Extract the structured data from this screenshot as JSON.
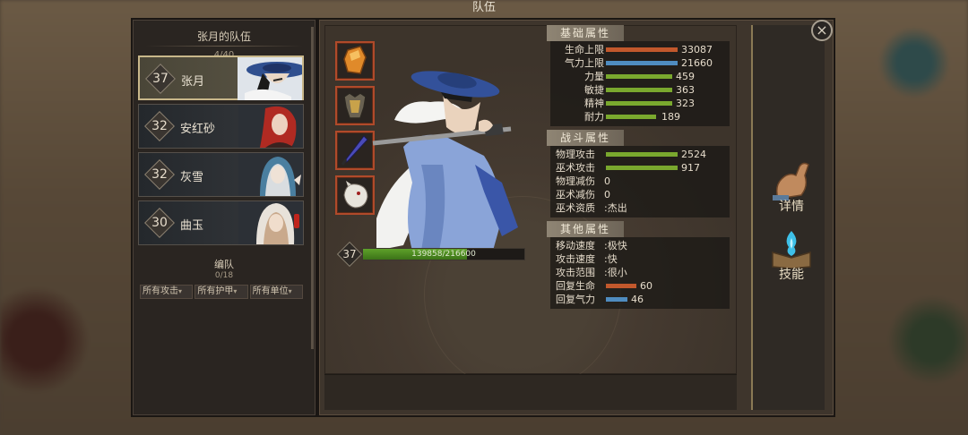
{
  "window": {
    "title": "队伍",
    "close_icon": "close-icon"
  },
  "team": {
    "title": "张月的队伍",
    "count": "4/40",
    "heroes": [
      {
        "level": "37",
        "name": "张月",
        "selected": true,
        "warning": false
      },
      {
        "level": "32",
        "name": "安红砂",
        "selected": false,
        "warning": false
      },
      {
        "level": "32",
        "name": "灰雪",
        "selected": false,
        "warning": false
      },
      {
        "level": "30",
        "name": "曲玉",
        "selected": false,
        "warning": true
      }
    ],
    "formation_title": "编队",
    "formation_count": "0/18",
    "filters": [
      "所有攻击",
      "所有护甲",
      "所有单位"
    ]
  },
  "equipment": [
    {
      "name": "amber-gem-icon"
    },
    {
      "name": "armor-icon"
    },
    {
      "name": "blade-icon"
    },
    {
      "name": "beast-head-icon"
    }
  ],
  "hero": {
    "level": "37",
    "hp_text": "139858/216600",
    "hp_fraction": 0.6457
  },
  "stats": {
    "basic": {
      "header": "基础属性",
      "rows": [
        {
          "label": "生命上限",
          "value": "33087",
          "color": "#c2582c",
          "fill": 0.97
        },
        {
          "label": "气力上限",
          "value": "21660",
          "color": "#4f8cc0",
          "fill": 0.97
        },
        {
          "label": "力量",
          "value": "459",
          "color": "#7aa82e",
          "fill": 0.9
        },
        {
          "label": "敏捷",
          "value": "363",
          "color": "#7aa82e",
          "fill": 0.9
        },
        {
          "label": "精神",
          "value": "323",
          "color": "#7aa82e",
          "fill": 0.9
        },
        {
          "label": "耐力",
          "value": "189",
          "color": "#7aa82e",
          "fill": 0.9
        }
      ]
    },
    "combat": {
      "header": "战斗属性",
      "rows": [
        {
          "label": "物理攻击",
          "value": "2524",
          "color": "#7aa82e",
          "fill": 0.97
        },
        {
          "label": "巫术攻击",
          "value": "917",
          "color": "#7aa82e",
          "fill": 0.97
        }
      ],
      "text_rows": [
        {
          "label": "物理减伤",
          "value": "0"
        },
        {
          "label": "巫术减伤",
          "value": "0"
        },
        {
          "label": "巫术资质",
          "value": ":杰出"
        }
      ]
    },
    "other": {
      "header": "其他属性",
      "text_rows": [
        {
          "label": "移动速度",
          "value": ":极快"
        },
        {
          "label": "攻击速度",
          "value": ":快"
        },
        {
          "label": "攻击范围",
          "value": ":很小"
        }
      ],
      "rows": [
        {
          "label": "回复生命",
          "value": "60",
          "color": "#c2582c",
          "fill": 0.9
        },
        {
          "label": "回复气力",
          "value": "46",
          "color": "#4f8cc0",
          "fill": 0.9
        }
      ]
    }
  },
  "side_buttons": [
    {
      "label": "详情",
      "icon": "muscle-arm-icon"
    },
    {
      "label": "技能",
      "icon": "spellbook-icon"
    }
  ]
}
